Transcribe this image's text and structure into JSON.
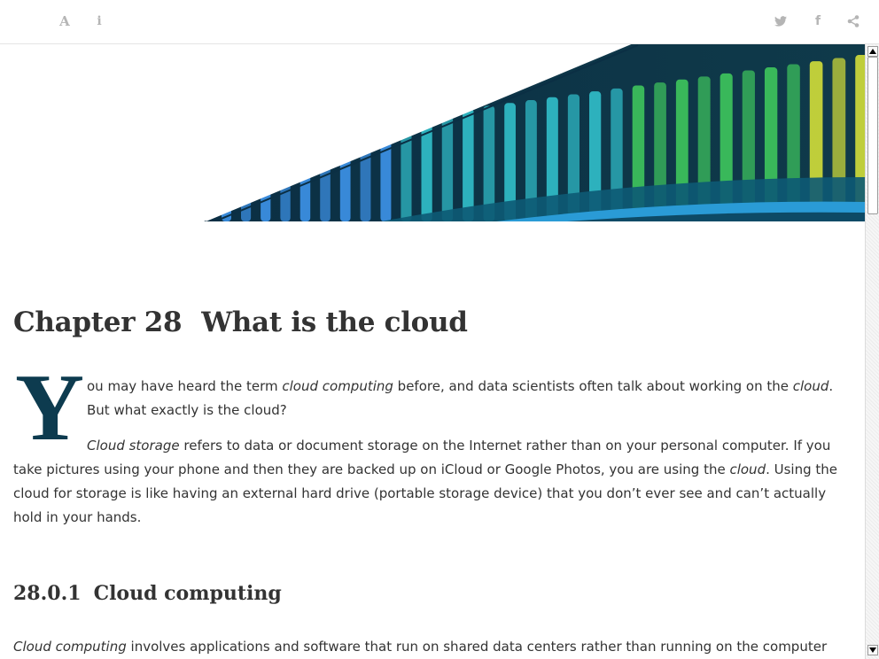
{
  "toolbar": {
    "left_buttons": [
      {
        "icon": "font-size-icon",
        "glyph": "A"
      },
      {
        "icon": "info-icon",
        "glyph": "i"
      }
    ],
    "right_buttons": [
      {
        "icon": "twitter-icon"
      },
      {
        "icon": "facebook-icon",
        "glyph": "f"
      },
      {
        "icon": "share-icon"
      }
    ]
  },
  "colors": {
    "heading": "#333333",
    "dropcap": "#0d3b4f",
    "toolbar_icon": "#b5b5b5",
    "banner_dark": "#0f3a4a",
    "banner_teal": "#2fb8c4",
    "banner_green": "#3cbf5c",
    "banner_lime": "#c9d63a",
    "banner_blue": "#3b8ee0"
  },
  "chapter": {
    "number": "Chapter 28",
    "title": "What is the cloud"
  },
  "intro": {
    "dropcap": "Y",
    "p1_a": "ou may have heard the term ",
    "p1_em1": "cloud computing",
    "p1_b": " before, and data scientists often talk about working on the ",
    "p1_em2": "cloud",
    "p1_c": ". But what exactly is the cloud?",
    "p2_em1": "Cloud storage",
    "p2_a": " refers to data or document storage on the Internet rather than on your personal computer. If you take pictures using your phone and then they are backed up on iCloud or Google Photos, you are using the ",
    "p2_em2": "cloud",
    "p2_b": ". Using the cloud for storage is like having an external hard drive (portable storage device) that you don’t ever see and can’t actually hold in your hands."
  },
  "section": {
    "number": "28.0.1",
    "title": "Cloud computing",
    "p1_em": "Cloud computing",
    "p1_a": " involves applications and software that run on shared data centers rather than running on the computer"
  }
}
